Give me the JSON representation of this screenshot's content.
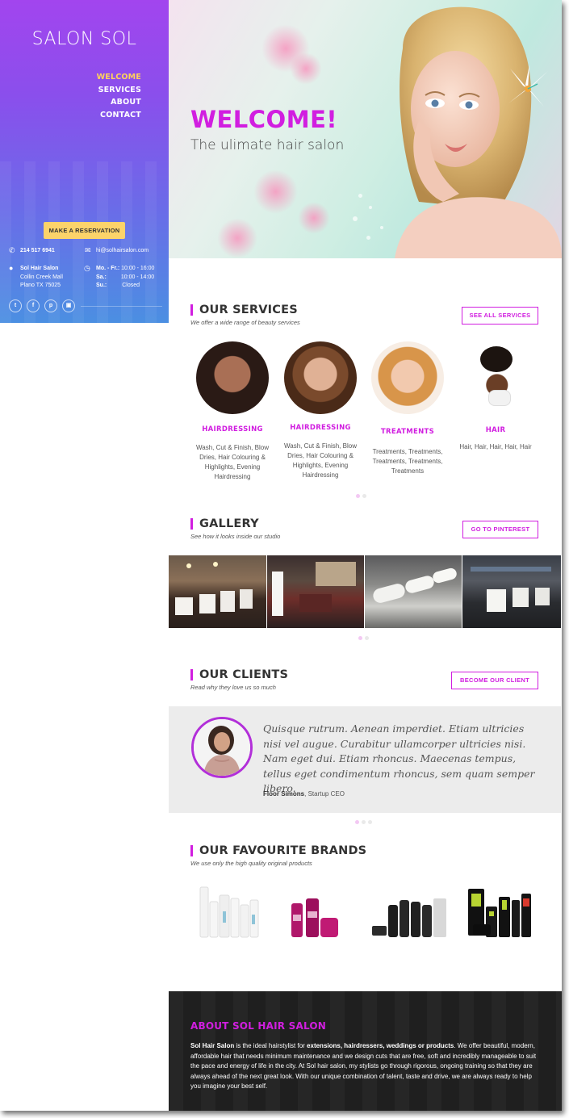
{
  "sidebar": {
    "brand": "SALON SOL",
    "nav": [
      {
        "label": "WELCOME",
        "active": true
      },
      {
        "label": "SERVICES",
        "active": false
      },
      {
        "label": "ABOUT",
        "active": false
      },
      {
        "label": "CONTACT",
        "active": false
      }
    ],
    "reserve_label": "MAKE A RESERVATION",
    "phone": "214 517 6941",
    "email": "hi@solhairsalon.com",
    "address": {
      "name": "Sol Hair Salon",
      "line1": "Collin Creek Mall",
      "line2": "Plano TX 75025"
    },
    "hours": [
      {
        "day": "Mo. - Fr.:",
        "time": "10:00 - 16:00"
      },
      {
        "day": "Sa.:",
        "time": "10:00 - 14:00"
      },
      {
        "day": "Su.:",
        "time": "Closed"
      }
    ],
    "social": [
      "twitter-icon",
      "facebook-icon",
      "pinterest-icon",
      "instagram-icon"
    ]
  },
  "hero": {
    "title": "WELCOME!",
    "subtitle": "The ulimate hair salon"
  },
  "services": {
    "title": "OUR SERVICES",
    "subtitle": "We offer a wide range of beauty services",
    "button": "SEE ALL SERVICES",
    "items": [
      {
        "title": "HAIRDRESSING",
        "desc": "Wash, Cut & Finish, Blow Dries, Hair Colouring & Highlights, Evening Hairdressing"
      },
      {
        "title": "HAIRDRESSING",
        "desc": "Wash, Cut & Finish, Blow Dries, Hair Colouring & Highlights, Evening Hairdressing"
      },
      {
        "title": "TREATMENTS",
        "desc": "Treatments, Treatments, Treatments, Treatments, Treatments"
      },
      {
        "title": "HAIR",
        "desc": "Hair, Hair, Hair, Hair, Hair"
      }
    ]
  },
  "gallery": {
    "title": "GALLERY",
    "subtitle": "See how it looks inside our studio",
    "button": "GO TO PINTEREST"
  },
  "clients": {
    "title": "OUR CLIENTS",
    "subtitle": "Read why they love us so much",
    "button": "BECOME OUR CLIENT",
    "quote": "Quisque rutrum. Aenean imperdiet. Etiam ultricies nisi vel augue. Curabitur ullamcorper ultricies nisi. Nam eget dui. Etiam rhoncus. Maecenas tempus, tellus eget condimentum rhoncus, sem quam semper libero.",
    "author_name": "Floor Simons",
    "author_role": ", Startup CEO"
  },
  "brands": {
    "title": "OUR FAVOURITE BRANDS",
    "subtitle": "We use only the high quality original products"
  },
  "about": {
    "title": "ABOUT SOL HAIR SALON",
    "text_lead": "Sol Hair Salon",
    "text_1": " is the ideal hairstylist for ",
    "text_bold": "extensions, hairdressers, weddings or products",
    "text_2": ". We offer beautiful, modern, affordable hair that needs minimum maintenance and we design cuts that are free, soft and incredibly manageable to suit the pace and energy of life in the city. At Sol hair salon, my stylists go through rigorous, ongoing training so that they are always ahead of the next great look. With our unique combination of talent, taste and drive, we are always ready to help you imagine your best self."
  },
  "colors": {
    "accent": "#d11ee0",
    "reserve_button": "#fcd36a",
    "nav_active": "#ffd25a"
  }
}
